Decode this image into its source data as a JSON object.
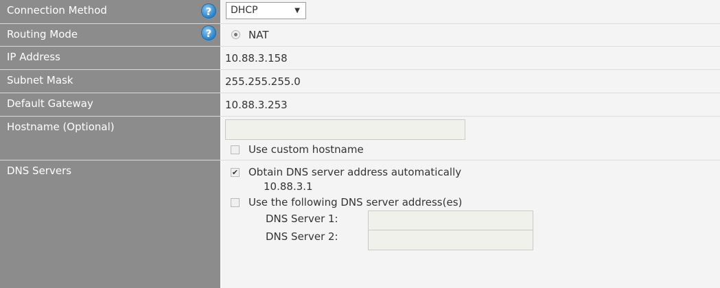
{
  "rows": {
    "connection_method": {
      "label": "Connection Method",
      "help": "?",
      "select_value": "DHCP",
      "select_arrow": "▼"
    },
    "routing_mode": {
      "label": "Routing Mode",
      "help": "?",
      "radio_label": "NAT"
    },
    "ip_address": {
      "label": "IP Address",
      "value": "10.88.3.158"
    },
    "subnet_mask": {
      "label": "Subnet Mask",
      "value": "255.255.255.0"
    },
    "default_gateway": {
      "label": "Default Gateway",
      "value": "10.88.3.253"
    },
    "hostname": {
      "label": "Hostname (Optional)",
      "input_value": "",
      "checkbox_label": "Use custom hostname",
      "checkbox_checked": false
    },
    "dns_servers": {
      "label": "DNS Servers",
      "auto_label": "Obtain DNS server address automatically",
      "auto_checked": true,
      "auto_address": "10.88.3.1",
      "manual_label": "Use the following DNS server address(es)",
      "manual_checked": false,
      "server1_label": "DNS Server 1:",
      "server1_value": "",
      "server2_label": "DNS Server 2:",
      "server2_value": ""
    }
  },
  "colors": {
    "label_bg": "#8c8c8c",
    "value_bg": "#f4f4f4",
    "help_icon": "#2a82c9"
  }
}
